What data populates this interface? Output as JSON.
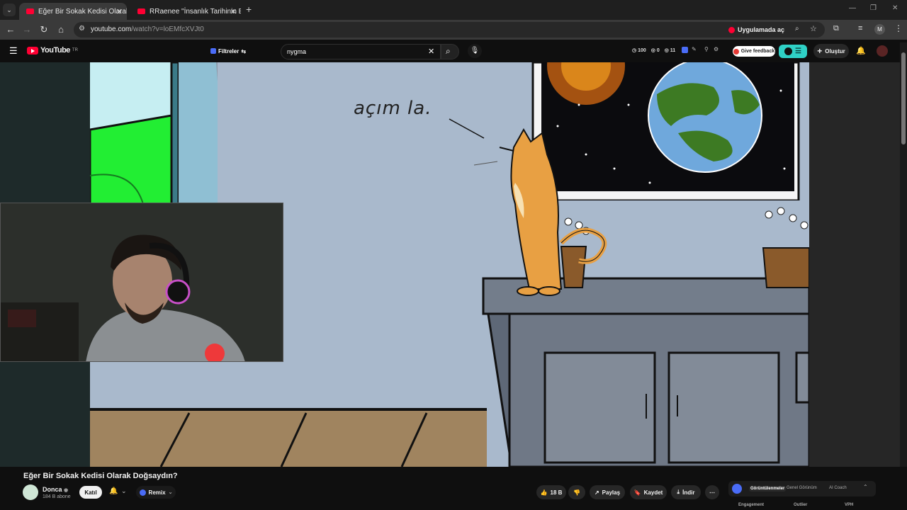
{
  "browser": {
    "tabs": [
      {
        "title": "Eğer Bir Sokak Kedisi Olarak Do",
        "active": true
      },
      {
        "title": "RRaenee \"İnsanlık Tarihinin En",
        "active": false
      }
    ],
    "new_tab": "+",
    "url_host": "youtube.com",
    "url_path": "/watch?v=loEMfcXVJt0",
    "open_in_app": "Uygulamada aç"
  },
  "youtube": {
    "logo_text": "YouTube",
    "country": "TR",
    "filters_label": "Filtreler",
    "search_value": "nygma",
    "stats": {
      "a": "100",
      "b": "0",
      "c": "11"
    },
    "feedback_label": "Give feedback",
    "create_label": "Oluştur",
    "avatar_letter": "M"
  },
  "video": {
    "speech_text": "açım la."
  },
  "info": {
    "title": "Eğer Bir Sokak Kedisi Olarak Doğsaydın?",
    "channel": "Donca",
    "subscribers": "184 B abone",
    "join_label": "Katıl",
    "remix_label": "Remix",
    "likes": "18 B",
    "share_label": "Paylaş",
    "save_label": "Kaydet",
    "download_label": "İndir",
    "panel_tabs": [
      "Görüntülenmeler",
      "Genel Görünüm",
      "AI Coach"
    ],
    "panel_cols": [
      "Engagement",
      "Outlier",
      "VPH"
    ]
  },
  "colors": {
    "brand_red": "#ff0033",
    "accent_teal": "#2fd1c6",
    "dark_bg": "#0f0f0f"
  }
}
